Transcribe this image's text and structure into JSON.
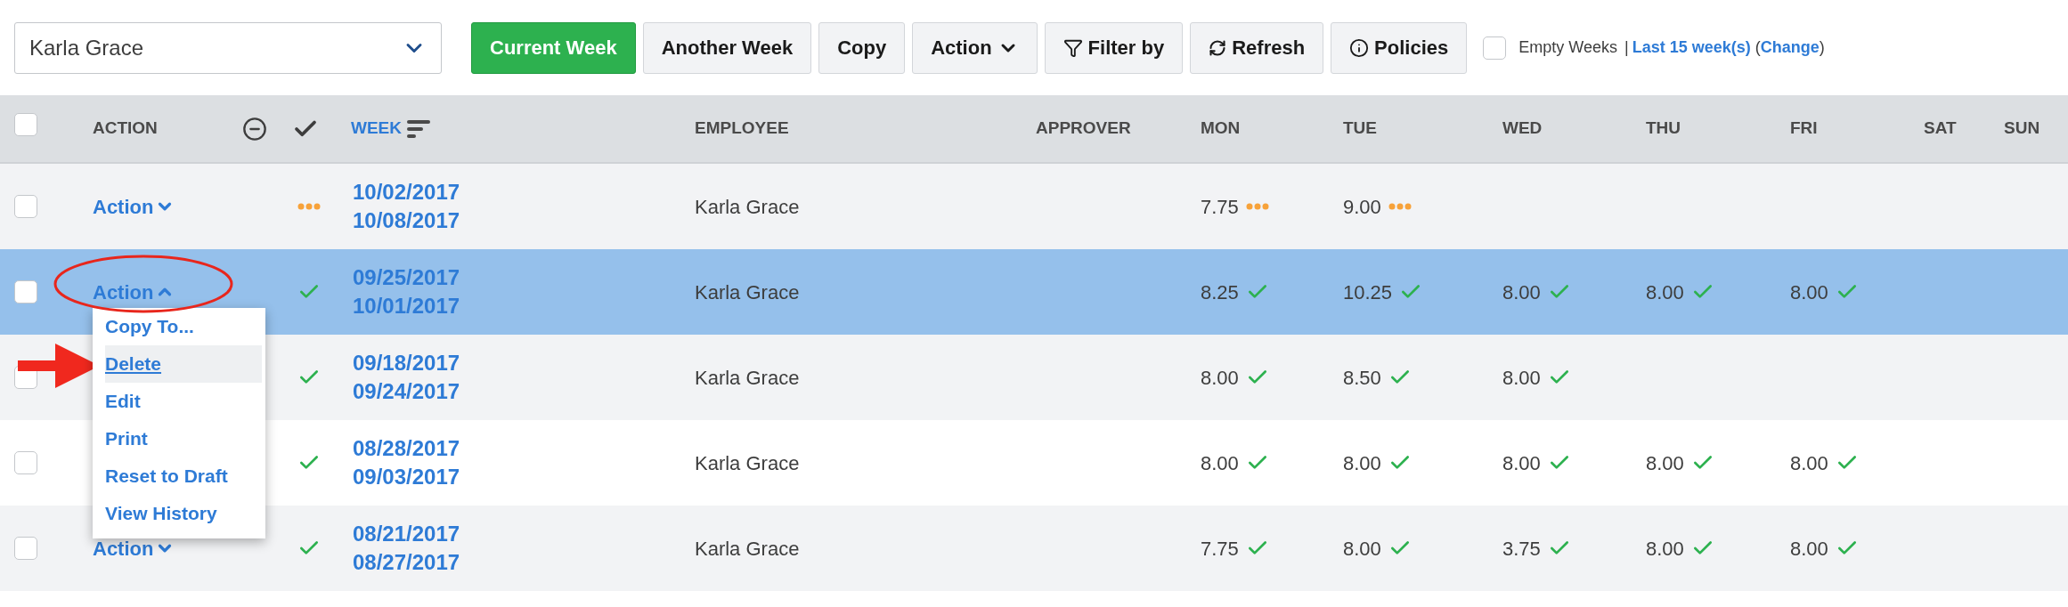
{
  "toolbar": {
    "employee_select": {
      "value": "Karla Grace"
    },
    "buttons": [
      {
        "label": "Current Week",
        "kind": "plain",
        "selected": true
      },
      {
        "label": "Another Week",
        "kind": "plain",
        "selected": false
      },
      {
        "label": "Copy",
        "kind": "plain",
        "selected": false
      },
      {
        "label": "Action",
        "kind": "dropdown",
        "selected": false
      },
      {
        "label": "Filter by",
        "kind": "filter",
        "selected": false
      },
      {
        "label": "Refresh",
        "kind": "refresh",
        "selected": false
      },
      {
        "label": "Policies",
        "kind": "info",
        "selected": false
      }
    ],
    "empty_weeks": {
      "checked": false,
      "label": "Empty Weeks",
      "separator": "|",
      "range_link": "Last 15 week(s)",
      "paren_open": "(",
      "change_link": "Change",
      "paren_close": ")"
    }
  },
  "table": {
    "select_all": {
      "checked": false
    },
    "columns": [
      {
        "label": "ACTION",
        "sorted": false
      },
      {
        "label": "WEEK",
        "sorted": true
      },
      {
        "label": "EMPLOYEE",
        "sorted": false
      },
      {
        "label": "APPROVER",
        "sorted": false
      },
      {
        "label": "MON",
        "sorted": false
      },
      {
        "label": "TUE",
        "sorted": false
      },
      {
        "label": "WED",
        "sorted": false
      },
      {
        "label": "THU",
        "sorted": false
      },
      {
        "label": "FRI",
        "sorted": false
      },
      {
        "label": "SAT",
        "sorted": false
      },
      {
        "label": "SUN",
        "sorted": false
      }
    ],
    "rows": [
      {
        "selected": false,
        "checked": false,
        "action": "Action",
        "expanded": false,
        "approved": false,
        "week_start": "10/02/2017",
        "week_end": "10/08/2017",
        "employee": "Karla Grace",
        "days": [
          {
            "hours": "7.75",
            "approved": false
          },
          {
            "hours": "9.00",
            "approved": false
          }
        ]
      },
      {
        "selected": true,
        "checked": false,
        "action": "Action",
        "expanded": true,
        "approved": true,
        "week_start": "09/25/2017",
        "week_end": "10/01/2017",
        "employee": "Karla Grace",
        "days": [
          {
            "hours": "8.25",
            "approved": true
          },
          {
            "hours": "10.25",
            "approved": true
          },
          {
            "hours": "8.00",
            "approved": true
          },
          {
            "hours": "8.00",
            "approved": true
          },
          {
            "hours": "8.00",
            "approved": true
          }
        ]
      },
      {
        "selected": false,
        "checked": false,
        "approved": true,
        "week_start": "09/18/2017",
        "week_end": "09/24/2017",
        "employee": "Karla Grace",
        "days": [
          {
            "hours": "8.00",
            "approved": true
          },
          {
            "hours": "8.50",
            "approved": true
          },
          {
            "hours": "8.00",
            "approved": true
          }
        ]
      },
      {
        "selected": false,
        "checked": false,
        "approved": true,
        "week_start": "08/28/2017",
        "week_end": "09/03/2017",
        "employee": "Karla Grace",
        "days": [
          {
            "hours": "8.00",
            "approved": true
          },
          {
            "hours": "8.00",
            "approved": true
          },
          {
            "hours": "8.00",
            "approved": true
          },
          {
            "hours": "8.00",
            "approved": true
          },
          {
            "hours": "8.00",
            "approved": true
          }
        ]
      },
      {
        "selected": false,
        "checked": false,
        "action": "Action",
        "expanded": false,
        "approved": true,
        "week_start": "08/21/2017",
        "week_end": "08/27/2017",
        "employee": "Karla Grace",
        "days": [
          {
            "hours": "7.75",
            "approved": true
          },
          {
            "hours": "8.00",
            "approved": true
          },
          {
            "hours": "3.75",
            "approved": true
          },
          {
            "hours": "8.00",
            "approved": true
          },
          {
            "hours": "8.00",
            "approved": true
          }
        ]
      }
    ]
  },
  "action_menu": {
    "items": [
      {
        "label": "Copy To...",
        "selected": false
      },
      {
        "label": "Delete",
        "selected": true
      },
      {
        "label": "Edit",
        "selected": false
      },
      {
        "label": "Print",
        "selected": false
      },
      {
        "label": "Reset to Draft",
        "selected": false
      },
      {
        "label": "View History",
        "selected": false
      }
    ]
  }
}
